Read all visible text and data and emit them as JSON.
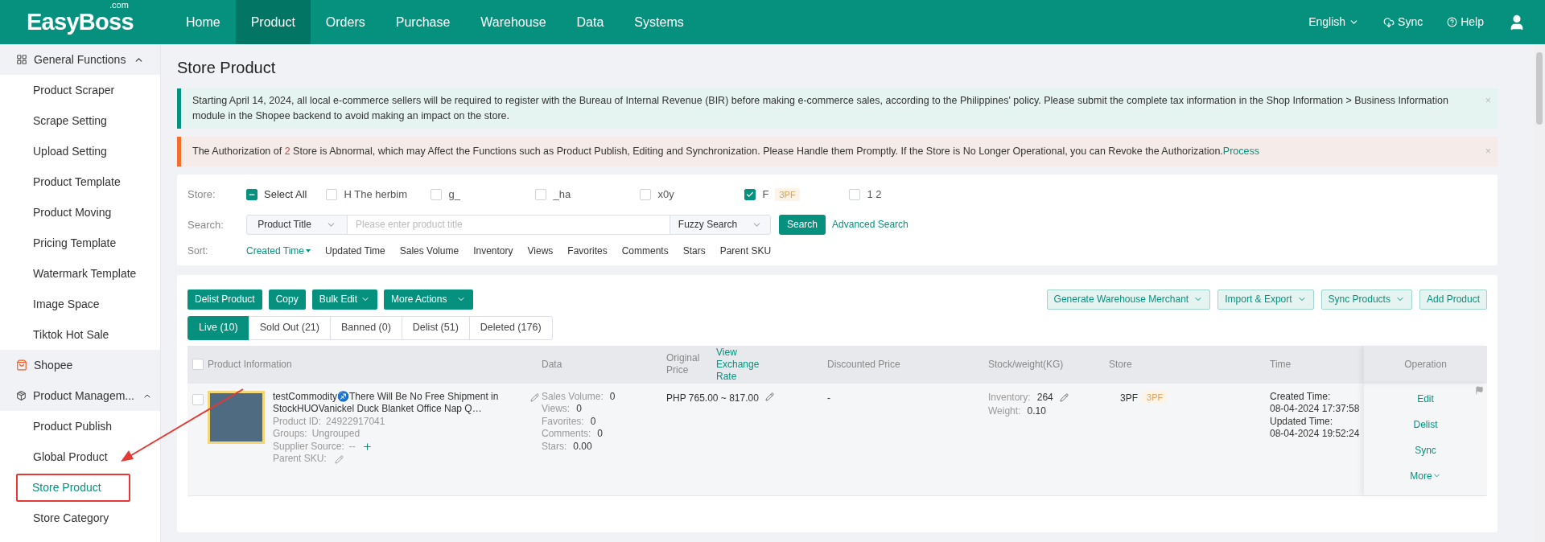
{
  "nav": {
    "logo": "EasyBoss",
    "logo_sup": ".com",
    "items": [
      {
        "label": "Home",
        "selected": false
      },
      {
        "label": "Product",
        "selected": true
      },
      {
        "label": "Orders",
        "selected": false
      },
      {
        "label": "Purchase",
        "selected": false
      },
      {
        "label": "Warehouse",
        "selected": false
      },
      {
        "label": "Data",
        "selected": false
      },
      {
        "label": "Systems",
        "selected": false
      }
    ],
    "language": "English",
    "sync": "Sync",
    "help": "Help"
  },
  "sidebar": [
    {
      "label": "General Functions",
      "kind": "grid",
      "expanded": true,
      "children": [
        {
          "label": "Product Scraper",
          "selected": false,
          "highlighted": false
        },
        {
          "label": "Scrape Setting",
          "selected": false,
          "highlighted": false
        },
        {
          "label": "Upload Setting",
          "selected": false,
          "highlighted": false
        },
        {
          "label": "Product Template",
          "selected": false,
          "highlighted": false
        },
        {
          "label": "Product Moving",
          "selected": false,
          "highlighted": false
        },
        {
          "label": "Pricing Template",
          "selected": false,
          "highlighted": false
        },
        {
          "label": "Watermark Template",
          "selected": false,
          "highlighted": false
        },
        {
          "label": "Image Space",
          "selected": false,
          "highlighted": false
        },
        {
          "label": "Tiktok Hot Sale",
          "selected": false,
          "highlighted": false
        }
      ]
    },
    {
      "label": "Shopee",
      "kind": "shop"
    },
    {
      "label": "Product Managem...",
      "kind": "box",
      "expanded": true,
      "children": [
        {
          "label": "Product Publish",
          "selected": false,
          "highlighted": false
        },
        {
          "label": "Global Product",
          "selected": false,
          "highlighted": false
        },
        {
          "label": "Store Product",
          "selected": true,
          "highlighted": true
        },
        {
          "label": "Store Category",
          "selected": false,
          "highlighted": false
        }
      ]
    }
  ],
  "title": "Store Product",
  "notice": {
    "text": "Starting April 14, 2024, all local e-commerce sellers will be required to register with the Bureau of Internal Revenue (BIR) before making e-commerce sales, according to the Philippines' policy. Please submit the complete tax information in the Shop Information > Business Information module in the Shopee backend to avoid making an impact on the store.",
    "close": "×"
  },
  "alert": {
    "before": "The Authorization of ",
    "count": "2",
    "after": " Store is Abnormal, which may Affect the Functions such as Product Publish, Editing and Synchronization. Please Handle them Promptly. If the Store is No Longer Operational, you can Revoke the Authorization.",
    "link": "Process",
    "close": "×"
  },
  "filters": {
    "store_label": "Store:",
    "select_all": {
      "label": "Select All",
      "indeterminate": true
    },
    "stores": [
      {
        "label": "H The herbim",
        "checked": false
      },
      {
        "label": "g_",
        "checked": false
      },
      {
        "label": "_ha",
        "checked": false
      },
      {
        "label": "x0y",
        "checked": false
      },
      {
        "label": "F",
        "checked": true,
        "tag": "3PF"
      },
      {
        "label": "1 2",
        "checked": false
      }
    ],
    "search_label": "Search:",
    "search_field": "Product Title",
    "placeholder": "Please enter product title",
    "search_mode": "Fuzzy Search",
    "search_button": "Search",
    "advanced": "Advanced Search",
    "sort_label": "Sort:",
    "sort": [
      {
        "label": "Created Time",
        "selected": true
      },
      {
        "label": "Updated Time",
        "selected": false
      },
      {
        "label": "Sales Volume",
        "selected": false
      },
      {
        "label": "Inventory",
        "selected": false
      },
      {
        "label": "Views",
        "selected": false
      },
      {
        "label": "Favorites",
        "selected": false
      },
      {
        "label": "Comments",
        "selected": false
      },
      {
        "label": "Stars",
        "selected": false
      },
      {
        "label": "Parent SKU",
        "selected": false
      }
    ]
  },
  "actions": [
    {
      "label": "Delist Product",
      "dropdown": false
    },
    {
      "label": "Copy",
      "dropdown": false
    },
    {
      "label": "Bulk Edit",
      "dropdown": true
    },
    {
      "label": "More Actions",
      "dropdown": true
    }
  ],
  "right_actions": [
    {
      "label": "Generate Warehouse Merchant",
      "dropdown": true
    },
    {
      "label": "Import & Export",
      "dropdown": true
    },
    {
      "label": "Sync Products",
      "dropdown": true
    },
    {
      "label": "Add Product",
      "dropdown": false
    }
  ],
  "tabs": [
    {
      "label": "Live (10)",
      "selected": true
    },
    {
      "label": "Sold Out (21)",
      "selected": false
    },
    {
      "label": "Banned (0)",
      "selected": false
    },
    {
      "label": "Delist (51)",
      "selected": false
    },
    {
      "label": "Deleted (176)",
      "selected": false
    }
  ],
  "table": {
    "select_all_checked": false,
    "columns": [
      {
        "label": "Product Information"
      },
      {
        "label": "Data"
      },
      {
        "label": "Original Price",
        "link": "View Exchange Rate"
      },
      {
        "label": "Discounted Price"
      },
      {
        "label": "Stock/weight(KG)"
      },
      {
        "label": "Store"
      },
      {
        "label": "Time"
      },
      {
        "label": "Operation"
      }
    ],
    "rows": [
      {
        "checked": false,
        "title": "testCommodity♐There Will Be No Free Shipment in StockHUOVanickel Duck Blanket Office Nap Q…",
        "info": [
          {
            "label": "Product ID:",
            "value": "24922917041"
          },
          {
            "label": "Groups:",
            "value": "Ungrouped"
          },
          {
            "label": "Supplier Source:",
            "value": "--",
            "kind": "add"
          },
          {
            "label": "Parent SKU:",
            "kind": "edit"
          }
        ],
        "data": [
          {
            "label": "Sales Volume:",
            "value": "0"
          },
          {
            "label": "Views:",
            "value": "0"
          },
          {
            "label": "Favorites:",
            "value": "0"
          },
          {
            "label": "Comments:",
            "value": "0"
          },
          {
            "label": "Stars:",
            "value": "0.00"
          }
        ],
        "price": "PHP 765.00 ~ 817.00",
        "discounted": "-",
        "stock": [
          {
            "label": "Inventory:",
            "value": "264",
            "kind": "edit"
          },
          {
            "label": "Weight:",
            "value": "0.10"
          }
        ],
        "store": "3PF",
        "store_tag": "3PF",
        "times": [
          "Created Time:",
          "08-04-2024 17:37:58",
          "Updated Time:",
          "08-04-2024 19:52:24"
        ],
        "operations": [
          {
            "label": "Edit",
            "dropdown": false
          },
          {
            "label": "Delist",
            "dropdown": false
          },
          {
            "label": "Sync",
            "dropdown": false
          },
          {
            "label": "More",
            "dropdown": true
          }
        ]
      }
    ]
  }
}
